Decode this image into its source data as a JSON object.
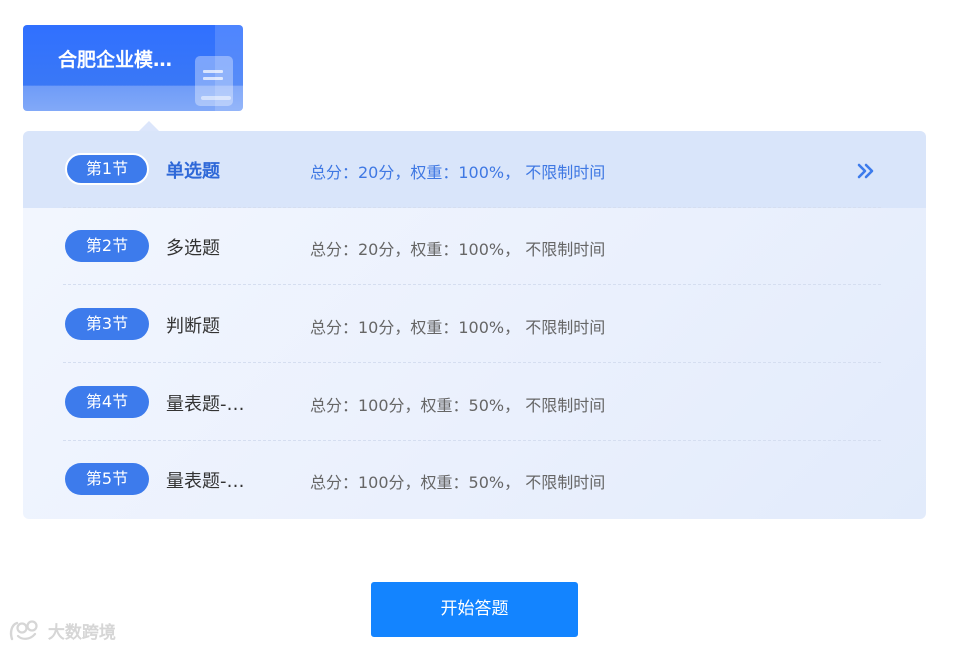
{
  "exam": {
    "title": "合肥企业模拟测评"
  },
  "sections": [
    {
      "badge": "第1节",
      "name": "单选题",
      "info": "总分：20分，权重：100%， 不限制时间",
      "active": true
    },
    {
      "badge": "第2节",
      "name": "多选题",
      "info": "总分：20分，权重：100%， 不限制时间",
      "active": false
    },
    {
      "badge": "第3节",
      "name": "判断题",
      "info": "总分：10分，权重：100%， 不限制时间",
      "active": false
    },
    {
      "badge": "第4节",
      "name": "量表题-…",
      "info": "总分：100分，权重：50%， 不限制时间",
      "active": false
    },
    {
      "badge": "第5节",
      "name": "量表题-…",
      "info": "总分：100分，权重：50%， 不限制时间",
      "active": false
    }
  ],
  "actions": {
    "start_label": "开始答题"
  },
  "watermark": {
    "text": "大数跨境"
  },
  "icons": {
    "exam_tab": "document-icon",
    "active_row": "double-chevron-right-icon",
    "watermark": "logo-icon"
  },
  "colors": {
    "primary": "#3d7bec",
    "button": "#1384ff",
    "active_row": "#d9e5fa",
    "active_text": "#2e68d8"
  }
}
